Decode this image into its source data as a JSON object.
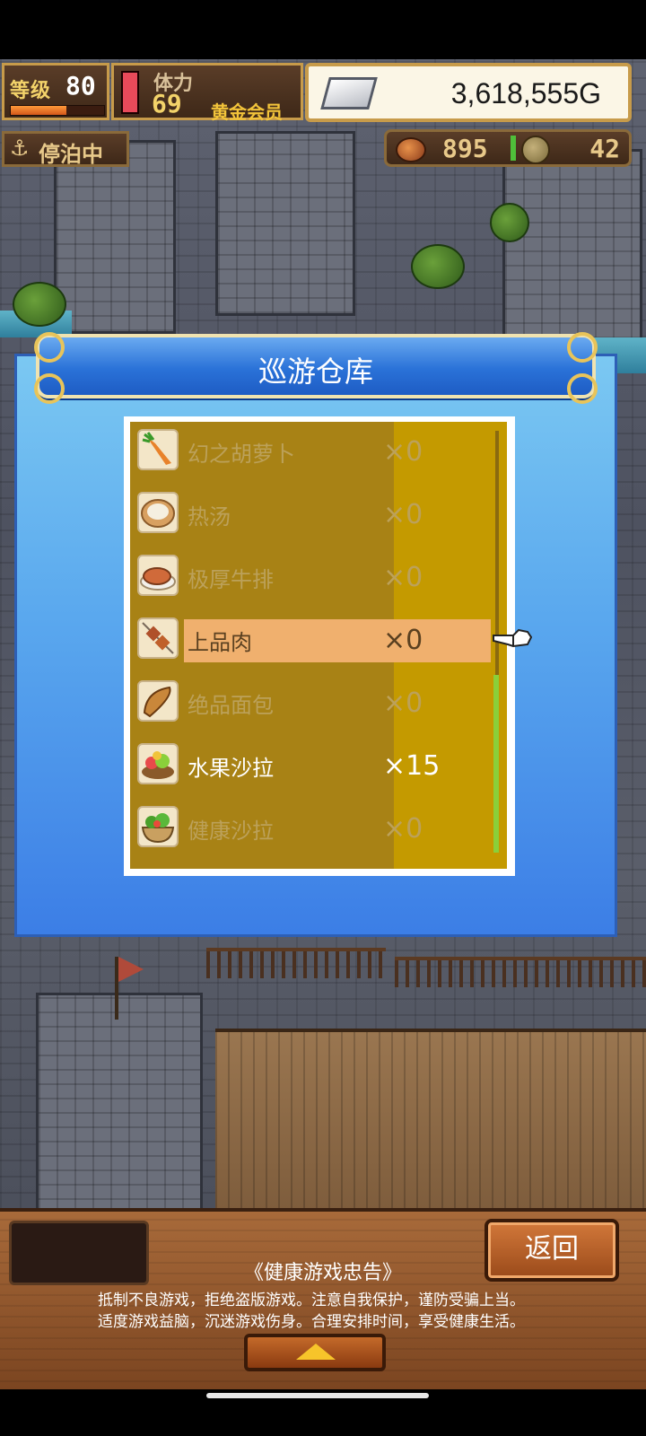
{
  "hud": {
    "level_label": "等级",
    "level": "80",
    "level_progress": 0.6,
    "stamina_label": "体力",
    "stamina": "69",
    "stamina_gauge_level": 1.0,
    "membership": "黄金会员",
    "gold": "3,618,555G",
    "status": "停泊中",
    "food": "895",
    "coins": "42"
  },
  "dialog": {
    "title": "巡游仓库",
    "items": [
      {
        "name": "幻之胡萝卜",
        "qty": "×0",
        "icon": "carrot-icon"
      },
      {
        "name": "热汤",
        "qty": "×0",
        "icon": "soup-icon"
      },
      {
        "name": "极厚牛排",
        "qty": "×0",
        "icon": "steak-icon"
      },
      {
        "name": "上品肉",
        "qty": "×0",
        "icon": "meat-skewer-icon"
      },
      {
        "name": "绝品面包",
        "qty": "×0",
        "icon": "bread-icon"
      },
      {
        "name": "水果沙拉",
        "qty": "×15",
        "icon": "fruit-salad-icon"
      },
      {
        "name": "健康沙拉",
        "qty": "×0",
        "icon": "salad-icon"
      }
    ]
  },
  "bottom": {
    "back_label": "返回",
    "notice_title": "《健康游戏忠告》",
    "notice_line1": "抵制不良游戏，拒绝盗版游戏。注意自我保护，谨防受骗上当。",
    "notice_line2": "适度游戏益脑，沉迷游戏伤身。合理安排时间，享受健康生活。"
  },
  "colors": {
    "dialog_blue": "#3c7ee6",
    "list_gold": "#a88215",
    "highlight": "#f0b06e",
    "wood": "#7a4420"
  }
}
